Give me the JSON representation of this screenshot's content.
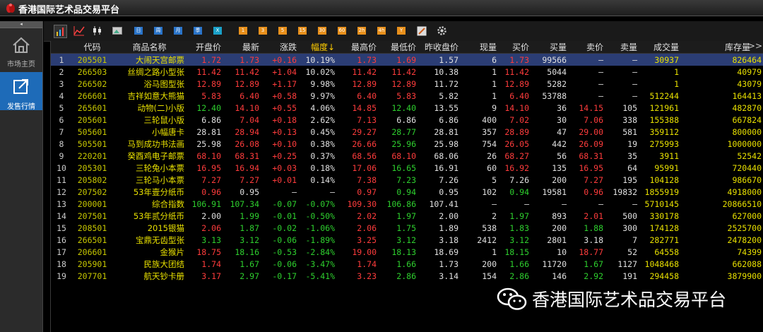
{
  "app": {
    "title": "香港国际艺术品交易平台"
  },
  "sidebar": {
    "collapse": "◂",
    "items": [
      {
        "label": "市场主页",
        "icon": "home-icon"
      },
      {
        "label": "发售行情",
        "icon": "export-icon"
      }
    ]
  },
  "toolbar": {
    "icons": [
      "bar-chart-icon",
      "line-chart-icon",
      "candlestick-icon",
      "image-icon"
    ],
    "period_buttons": [
      "日",
      "周",
      "月",
      "季",
      "X"
    ],
    "minute_buttons": [
      "1",
      "3",
      "5",
      "15",
      "30",
      "60",
      "2h",
      "4h",
      "Y"
    ],
    "tools": [
      "pen-icon",
      "gear-icon"
    ]
  },
  "table": {
    "headers": [
      "",
      "代码",
      "商品名称",
      "开盘价",
      "最新",
      "涨跌",
      "幅度↓",
      "最高价",
      "最低价",
      "昨收盘价",
      "现量",
      "买价",
      "买量",
      "卖价",
      "卖量",
      "成交量",
      "库存量"
    ],
    "more": ">>",
    "rows": [
      [
        "1",
        "205501",
        "大闹天宫邮票",
        "1.72",
        "1.73",
        "+0.16",
        "10.19%",
        "1.73",
        "1.69",
        "1.57",
        "6",
        "1.73",
        "99566",
        "—",
        "—",
        "30937",
        "826464"
      ],
      [
        "2",
        "266503",
        "丝绸之路小型张",
        "11.42",
        "11.42",
        "+1.04",
        "10.02%",
        "11.42",
        "11.42",
        "10.38",
        "1",
        "11.42",
        "5044",
        "—",
        "—",
        "1",
        "40979"
      ],
      [
        "3",
        "266502",
        "浴马图型张",
        "12.89",
        "12.89",
        "+1.17",
        "9.98%",
        "12.89",
        "12.89",
        "11.72",
        "1",
        "12.89",
        "5282",
        "—",
        "—",
        "1",
        "43079"
      ],
      [
        "4",
        "266601",
        "吉祥如意大熊猫",
        "5.83",
        "6.40",
        "+0.58",
        "9.97%",
        "6.40",
        "5.83",
        "5.82",
        "1",
        "6.40",
        "53788",
        "—",
        "—",
        "512244",
        "164413"
      ],
      [
        "5",
        "265601",
        "动物(二)小版",
        "12.40",
        "14.10",
        "+0.55",
        "4.06%",
        "14.85",
        "12.40",
        "13.55",
        "9",
        "14.10",
        "36",
        "14.15",
        "105",
        "121961",
        "482870"
      ],
      [
        "6",
        "205601",
        "三轮鼠小版",
        "6.86",
        "7.04",
        "+0.18",
        "2.62%",
        "7.13",
        "6.86",
        "6.86",
        "400",
        "7.02",
        "30",
        "7.06",
        "338",
        "155388",
        "667824"
      ],
      [
        "7",
        "505601",
        "小幅唐卡",
        "28.81",
        "28.94",
        "+0.13",
        "0.45%",
        "29.27",
        "28.77",
        "28.81",
        "357",
        "28.89",
        "47",
        "29.00",
        "581",
        "359112",
        "800000"
      ],
      [
        "8",
        "505501",
        "马到成功书法画",
        "25.98",
        "26.08",
        "+0.10",
        "0.38%",
        "26.66",
        "25.96",
        "25.98",
        "754",
        "26.05",
        "442",
        "26.09",
        "19",
        "275993",
        "1000000"
      ],
      [
        "9",
        "220201",
        "癸酉鸡电子邮票",
        "68.10",
        "68.31",
        "+0.25",
        "0.37%",
        "68.56",
        "68.10",
        "68.06",
        "26",
        "68.27",
        "56",
        "68.31",
        "35",
        "3911",
        "52542"
      ],
      [
        "10",
        "205301",
        "三轮兔小本票",
        "16.95",
        "16.94",
        "+0.03",
        "0.18%",
        "17.06",
        "16.65",
        "16.91",
        "60",
        "16.92",
        "135",
        "16.95",
        "64",
        "95991",
        "720440"
      ],
      [
        "11",
        "205802",
        "三轮马小本票",
        "7.27",
        "7.27",
        "+0.01",
        "0.14%",
        "7.38",
        "7.23",
        "7.26",
        "5",
        "7.26",
        "200",
        "7.27",
        "195",
        "104128",
        "986670"
      ],
      [
        "12",
        "207502",
        "53年壹分纸币",
        "0.96",
        "0.95",
        "—",
        "—",
        "0.97",
        "0.94",
        "0.95",
        "102",
        "0.94",
        "19581",
        "0.96",
        "19832",
        "1855919",
        "4918000"
      ],
      [
        "13",
        "200001",
        "综合指数",
        "106.91",
        "107.34",
        "-0.07",
        "-0.07%",
        "109.30",
        "106.86",
        "107.41",
        "—",
        "—",
        "—",
        "—",
        "—",
        "5710145",
        "20866510"
      ],
      [
        "14",
        "207501",
        "53年贰分纸币",
        "2.00",
        "1.99",
        "-0.01",
        "-0.50%",
        "2.02",
        "1.97",
        "2.00",
        "2",
        "1.97",
        "893",
        "2.01",
        "500",
        "330178",
        "627000"
      ],
      [
        "15",
        "208501",
        "2015银猫",
        "2.06",
        "1.87",
        "-0.02",
        "-1.06%",
        "2.06",
        "1.75",
        "1.89",
        "538",
        "1.83",
        "200",
        "1.88",
        "300",
        "174128",
        "2525700"
      ],
      [
        "16",
        "266501",
        "宝鼎无齿型张",
        "3.13",
        "3.12",
        "-0.06",
        "-1.89%",
        "3.25",
        "3.12",
        "3.18",
        "2412",
        "3.12",
        "2801",
        "3.18",
        "7",
        "282771",
        "2478200"
      ],
      [
        "17",
        "206601",
        "金猴片",
        "18.75",
        "18.16",
        "-0.53",
        "-2.84%",
        "19.00",
        "18.13",
        "18.69",
        "1",
        "18.15",
        "10",
        "18.77",
        "52",
        "64558",
        "74399"
      ],
      [
        "18",
        "205901",
        "民族大团结",
        "1.74",
        "1.67",
        "-0.06",
        "-3.47%",
        "1.74",
        "1.66",
        "1.73",
        "200",
        "1.66",
        "11720",
        "1.67",
        "1127",
        "1048468",
        "662088"
      ],
      [
        "19",
        "207701",
        "航天钞卡册",
        "3.17",
        "2.97",
        "-0.17",
        "-5.41%",
        "3.23",
        "2.86",
        "3.14",
        "154",
        "2.86",
        "146",
        "2.92",
        "191",
        "294458",
        "3879900"
      ]
    ]
  },
  "watermark": {
    "text": "香港国际艺术品交易平台",
    "icon": "wechat-icon"
  },
  "colors": {
    "up": "#ff3c3c",
    "down": "#2ed02e",
    "selected_row": "#2b3d74",
    "name": "#e8e000"
  }
}
